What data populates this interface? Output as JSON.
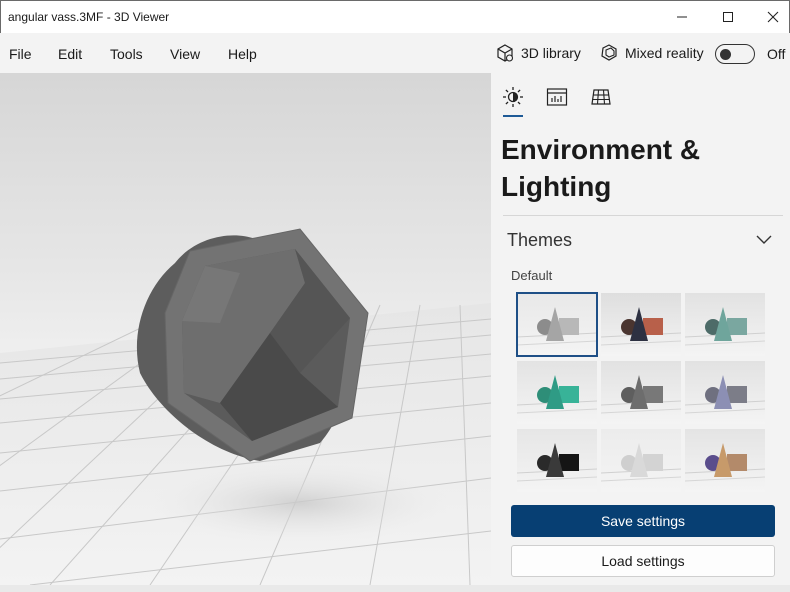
{
  "window": {
    "title": "angular vass.3MF - 3D Viewer",
    "controls": [
      "minimize-icon",
      "maximize-icon",
      "close-icon"
    ]
  },
  "menu": {
    "items": [
      {
        "label": "File"
      },
      {
        "label": "Edit"
      },
      {
        "label": "Tools"
      },
      {
        "label": "View"
      },
      {
        "label": "Help"
      }
    ],
    "library_label": "3D library",
    "mixed_reality_label": "Mixed reality",
    "toggle_state": "Off"
  },
  "panel": {
    "tabs": [
      {
        "name": "lighting",
        "icon": "sun-icon",
        "selected": true
      },
      {
        "name": "stats",
        "icon": "stats-icon",
        "selected": false
      },
      {
        "name": "grid",
        "icon": "grid-icon",
        "selected": false
      }
    ],
    "title": "Environment & Lighting",
    "section": "Themes",
    "theme_group": "Default",
    "themes": [
      {
        "bg": "#e8e8e8",
        "sphere": "#8c8c8c",
        "cone": "#a5a5a5",
        "box": "#b8b8b8",
        "selected": true
      },
      {
        "bg": "#dedede",
        "sphere": "#4a3530",
        "cone": "#2d3142",
        "box": "#b8604a",
        "selected": false
      },
      {
        "bg": "#e2e2e2",
        "sphere": "#4d6b68",
        "cone": "#6fa59c",
        "box": "#7aa7a0",
        "selected": false
      },
      {
        "bg": "#e3e3e3",
        "sphere": "#2e8e78",
        "cone": "#2f9b85",
        "box": "#38b398",
        "selected": false
      },
      {
        "bg": "#e2e2e2",
        "sphere": "#5e5e5e",
        "cone": "#6d6d6d",
        "box": "#787878",
        "selected": false
      },
      {
        "bg": "#e2e2e2",
        "sphere": "#6f7080",
        "cone": "#8c8fb4",
        "box": "#7c7d88",
        "selected": false
      },
      {
        "bg": "#e6e6e6",
        "sphere": "#2a2a2a",
        "cone": "#3a3a3a",
        "box": "#151515",
        "selected": false
      },
      {
        "bg": "#ececec",
        "sphere": "#cfcfcf",
        "cone": "#d9d9d9",
        "box": "#d3d3d3",
        "selected": false
      },
      {
        "bg": "#e4e4e4",
        "sphere": "#5a4d8c",
        "cone": "#c79a6a",
        "box": "#b38a6a",
        "selected": false
      }
    ],
    "save_label": "Save settings",
    "load_label": "Load settings"
  },
  "colors": {
    "accent": "#073f73",
    "tab_underline": "#1e5a96",
    "panel_bg": "#f3f3f3",
    "model": "#6b6b6b"
  }
}
